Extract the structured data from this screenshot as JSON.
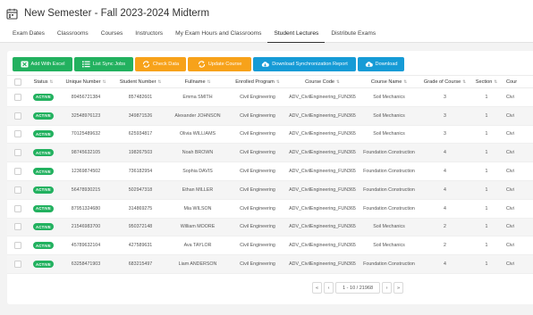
{
  "header": {
    "title": "New Semester - Fall 2023-2024 Midterm"
  },
  "tabs": [
    {
      "label": "Exam Dates"
    },
    {
      "label": "Classrooms"
    },
    {
      "label": "Courses"
    },
    {
      "label": "Instructors"
    },
    {
      "label": "My Exam Hours and Classrooms"
    },
    {
      "label": "Student Lectures"
    },
    {
      "label": "Distribute Exams"
    }
  ],
  "active_tab": "Student Lectures",
  "toolbar": {
    "add_with_excel": "Add With Excel",
    "list_sync_jobs": "List Sync Jobs",
    "check_data": "Check Data",
    "update_course": "Update Course",
    "download_sync_report": "Download Synchronization Report",
    "download": "Download"
  },
  "colors": {
    "green": "#22b15f",
    "orange": "#f7a21a",
    "blue": "#169bd6"
  },
  "table": {
    "columns": [
      "Status",
      "Unique Number",
      "Student Number",
      "Fullname",
      "Enrolled Program",
      "Course Code",
      "Course Name",
      "Grade of Course",
      "Section",
      "Cour"
    ],
    "rows": [
      {
        "status": "ACTIVE",
        "unique": "89456721384",
        "student": "857482601",
        "fullname": "Emma SMITH",
        "program": "Civil Engineering",
        "code": "ADV_CivilEngineering_FUN365",
        "course": "Soil Mechanics",
        "grade": "3",
        "section": "1",
        "cour": "Civi"
      },
      {
        "status": "ACTIVE",
        "unique": "32548976123",
        "student": "349871526",
        "fullname": "Alexander JOHNSON",
        "program": "Civil Engineering",
        "code": "ADV_CivilEngineering_FUN365",
        "course": "Soil Mechanics",
        "grade": "3",
        "section": "1",
        "cour": "Civi"
      },
      {
        "status": "ACTIVE",
        "unique": "70125489632",
        "student": "625934817",
        "fullname": "Olivia WILLIAMS",
        "program": "Civil Engineering",
        "code": "ADV_CivilEngineering_FUN365",
        "course": "Soil Mechanics",
        "grade": "3",
        "section": "1",
        "cour": "Civi"
      },
      {
        "status": "ACTIVE",
        "unique": "98745632105",
        "student": "198267503",
        "fullname": "Noah BROWN",
        "program": "Civil Engineering",
        "code": "ADV_CivilEngineering_FUN365",
        "course": "Foundation Construction",
        "grade": "4",
        "section": "1",
        "cour": "Civi"
      },
      {
        "status": "ACTIVE",
        "unique": "12369874502",
        "student": "736182954",
        "fullname": "Sophia DAVIS",
        "program": "Civil Engineering",
        "code": "ADV_CivilEngineering_FUN365",
        "course": "Foundation Construction",
        "grade": "4",
        "section": "1",
        "cour": "Civi"
      },
      {
        "status": "ACTIVE",
        "unique": "56478930215",
        "student": "502947318",
        "fullname": "Ethan MILLER",
        "program": "Civil Engineering",
        "code": "ADV_CivilEngineering_FUN365",
        "course": "Foundation Construction",
        "grade": "4",
        "section": "1",
        "cour": "Civi"
      },
      {
        "status": "ACTIVE",
        "unique": "87951324680",
        "student": "314869275",
        "fullname": "Mia WILSON",
        "program": "Civil Engineering",
        "code": "ADV_CivilEngineering_FUN365",
        "course": "Foundation Construction",
        "grade": "4",
        "section": "1",
        "cour": "Civi"
      },
      {
        "status": "ACTIVE",
        "unique": "21546983700",
        "student": "950372148",
        "fullname": "William MOORE",
        "program": "Civil Engineering",
        "code": "ADV_CivilEngineering_FUN365",
        "course": "Soil Mechanics",
        "grade": "2",
        "section": "1",
        "cour": "Civi"
      },
      {
        "status": "ACTIVE",
        "unique": "45789632104",
        "student": "427589631",
        "fullname": "Ava TAYLOR",
        "program": "Civil Engineering",
        "code": "ADV_CivilEngineering_FUN365",
        "course": "Soil Mechanics",
        "grade": "2",
        "section": "1",
        "cour": "Civi"
      },
      {
        "status": "ACTIVE",
        "unique": "63258471903",
        "student": "683215497",
        "fullname": "Liam ANDERSON",
        "program": "Civil Engineering",
        "code": "ADV_CivilEngineering_FUN365",
        "course": "Foundation Construction",
        "grade": "4",
        "section": "1",
        "cour": "Civi"
      }
    ]
  },
  "pagination": {
    "first": "«",
    "prev": "‹",
    "info": "1 - 10 / 21968",
    "next": "›",
    "last": "»"
  }
}
